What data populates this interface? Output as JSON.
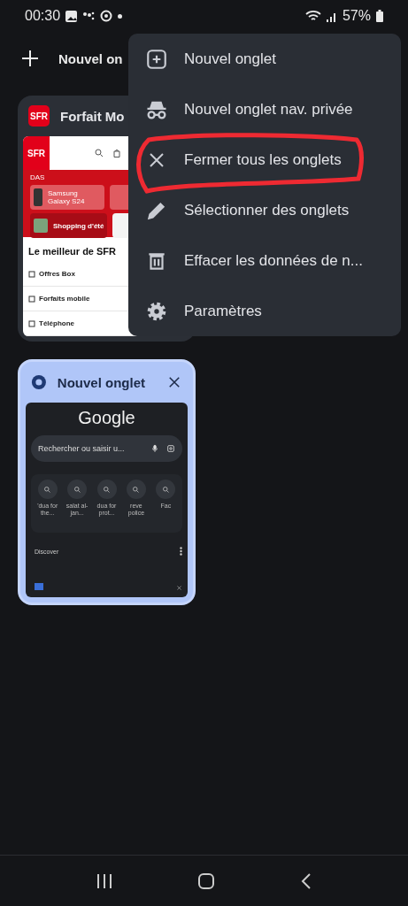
{
  "status_bar": {
    "time": "00:30",
    "battery": "57%"
  },
  "toolbar": {
    "new_tab_label": "Nouvel on"
  },
  "tabs": [
    {
      "kind": "sfr",
      "title": "Forfait Mo",
      "favicon_logo": "SFR",
      "selected": false,
      "preview": {
        "logo": "SFR",
        "das": "DAS",
        "product": "Samsung Galaxy S24",
        "promo": "Shopping d'été",
        "heading": "Le meilleur de SFR",
        "links": [
          "Offres Box",
          "Forfaits mobile",
          "Téléphone"
        ]
      }
    },
    {
      "kind": "ntp",
      "title": "Nouvel onglet",
      "selected": true,
      "preview": {
        "logo": "Google",
        "search_placeholder": "Rechercher ou saisir u...",
        "shortcuts": [
          "'dua for the...",
          "salat al-jan...",
          "dua for prot...",
          "reve police",
          "Fac"
        ],
        "feed_title": "Discover"
      }
    }
  ],
  "menu": {
    "items": [
      {
        "kind": "new",
        "label": "Nouvel onglet"
      },
      {
        "kind": "incognito",
        "label": "Nouvel onglet nav. privée"
      },
      {
        "kind": "close",
        "label": "Fermer tous les onglets"
      },
      {
        "kind": "select",
        "label": "Sélectionner des onglets"
      },
      {
        "kind": "clear",
        "label": "Effacer les données de n..."
      },
      {
        "kind": "settings",
        "label": "Paramètres"
      }
    ]
  }
}
